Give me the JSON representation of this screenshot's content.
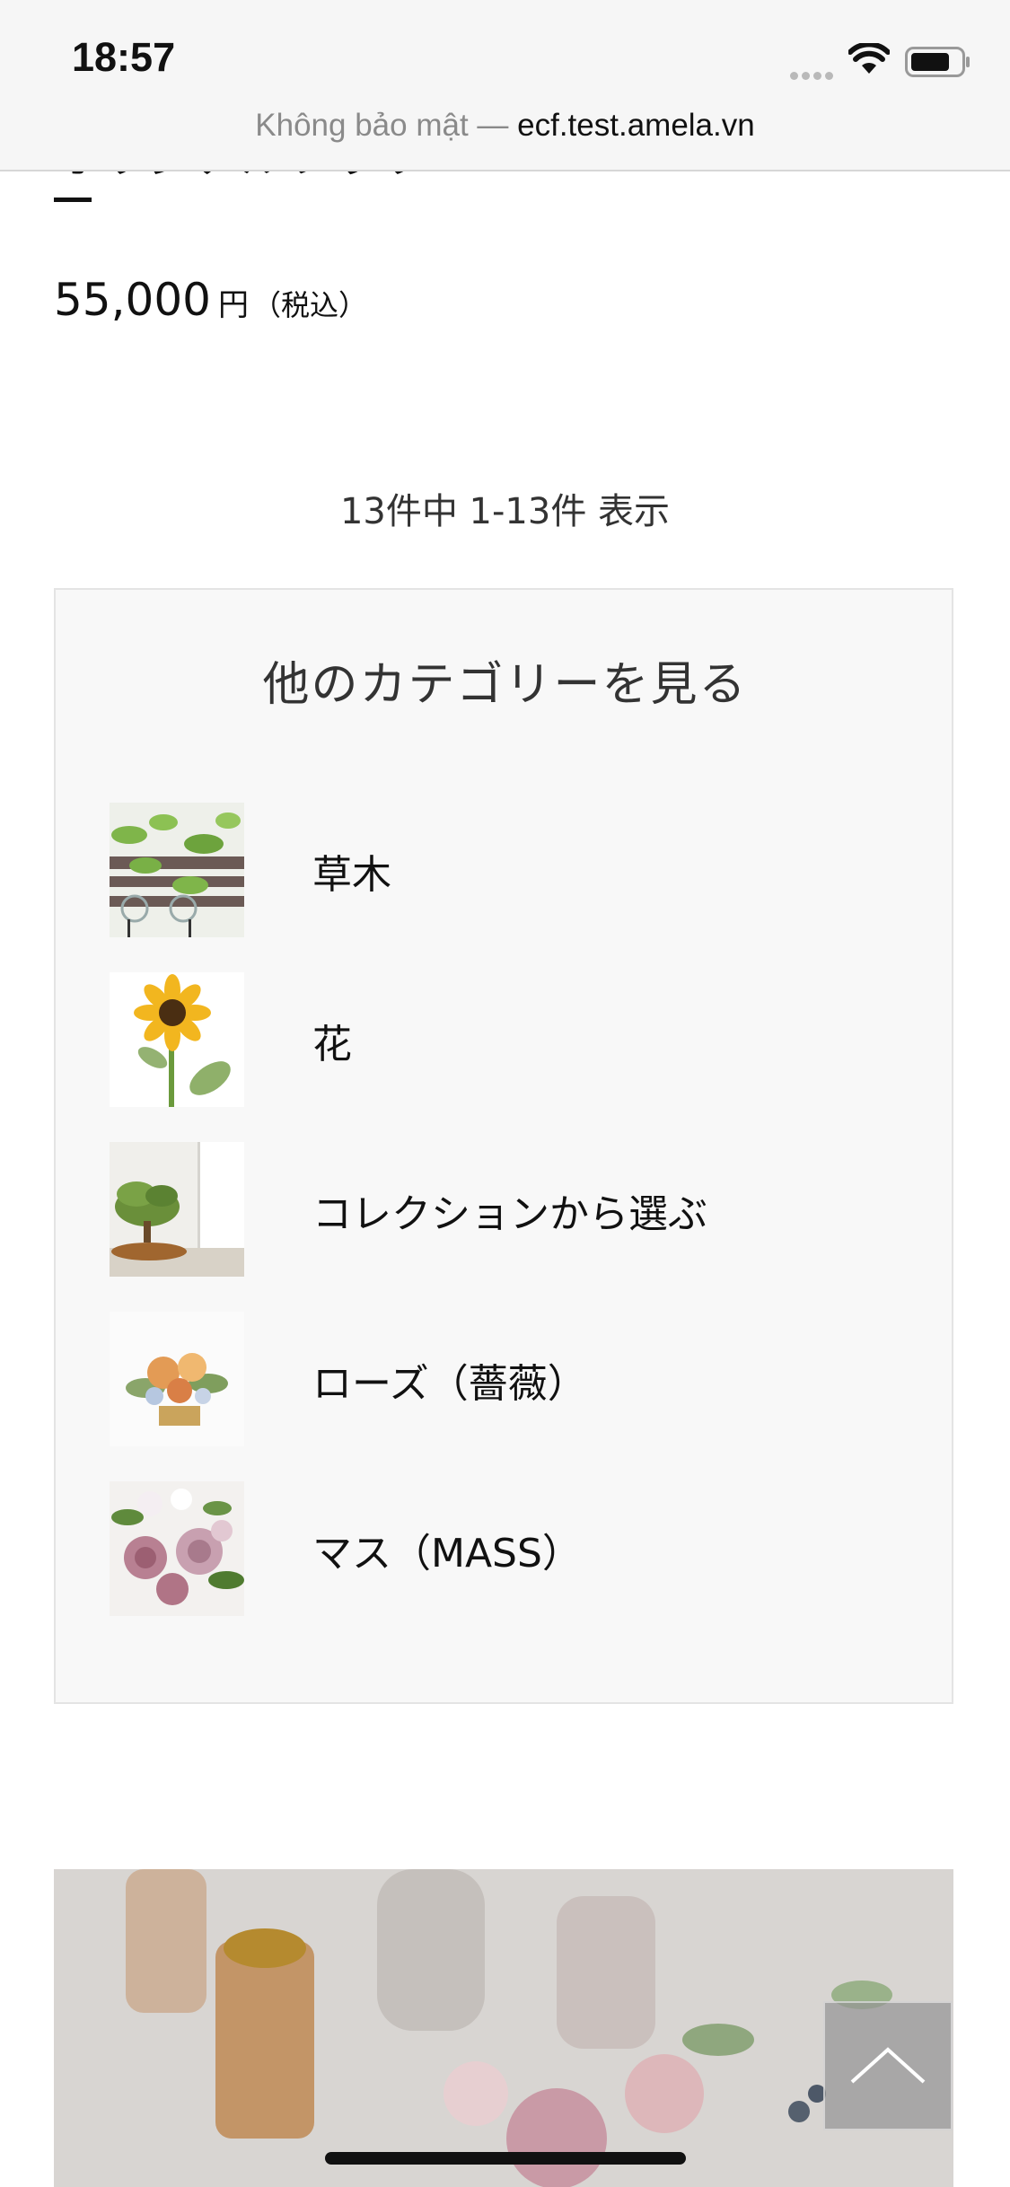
{
  "status_bar": {
    "time": "18:57"
  },
  "url_bar": {
    "insecure_label": "Không bảo mật —",
    "domain": "ecf.test.amela.vn"
  },
  "previous_product": {
    "title_fragment": "オリジナルフラワ",
    "price": "55,000",
    "currency": "円",
    "tax_note": "（税込）"
  },
  "pagination": {
    "summary": "13件中 1-13件 表示"
  },
  "categories": {
    "heading": "他のカテゴリーを見る",
    "items": [
      {
        "label": "草木",
        "icon": "plant-thumbnail"
      },
      {
        "label": "花",
        "icon": "sunflower-thumbnail"
      },
      {
        "label": "コレクションから選ぶ",
        "icon": "bonsai-thumbnail"
      },
      {
        "label": "ローズ（薔薇）",
        "icon": "rose-arrangement-thumbnail"
      },
      {
        "label": "マス（MASS）",
        "icon": "bouquet-thumbnail"
      }
    ]
  },
  "colors": {
    "panel_bg": "#f8f8f8",
    "panel_border": "#e4e4e4",
    "topbar_bg": "#f6f6f6"
  }
}
